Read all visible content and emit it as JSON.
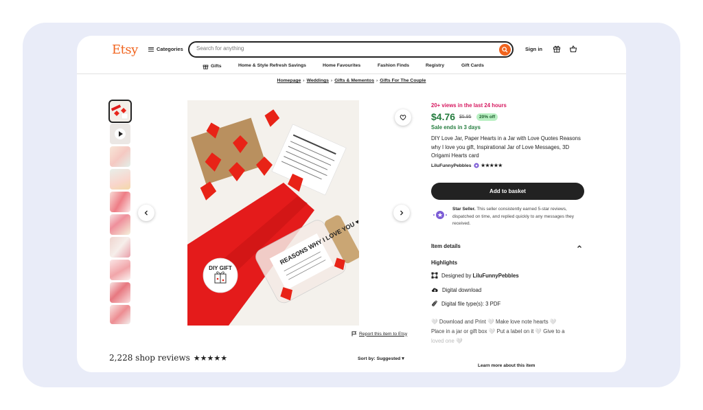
{
  "header": {
    "logo": "Etsy",
    "categories_label": "Categories",
    "search_placeholder": "Search for anything",
    "signin_label": "Sign in"
  },
  "nav": {
    "items": [
      "Gifts",
      "Home & Style Refresh Savings",
      "Home Favourites",
      "Fashion Finds",
      "Registry",
      "Gift Cards"
    ]
  },
  "breadcrumb": [
    "Homepage",
    "Weddings",
    "Gifts & Mementos",
    "Gifts For The Couple"
  ],
  "product": {
    "views": "20+ views in the last 24 hours",
    "price": "$4.76",
    "old_price": "$5.95",
    "discount": "20% off",
    "sale_ends": "Sale ends in 3 days",
    "title": "DIY Love Jar, Paper Hearts in a Jar with Love Quotes Reasons why I love you gift, Inspirational Jar of Love Messages, 3D Origami Hearts card",
    "seller": "LiluFunnyPebbles",
    "rating_stars": "★★★★★",
    "add_to_basket": "Add to basket",
    "star_seller_title": "Star Seller.",
    "star_seller_text": "This seller consistently earned 5-star reviews, dispatched on time, and replied quickly to any messages they received.",
    "image_badge": "DIY GIFT",
    "jar_label": "REASONS WHY I LOVE YOU ♥"
  },
  "details": {
    "heading": "Item details",
    "highlights_heading": "Highlights",
    "designed_by_prefix": "Designed by ",
    "designed_by": "LiluFunnyPebbles",
    "digital_download": "Digital download",
    "file_types": "Digital file type(s): 3 PDF",
    "description_line1": "🤍 Download and Print 🤍 Make love note hearts 🤍",
    "description_line2": "Place in a jar or gift box 🤍 Put a label on it 🤍 Give to a",
    "description_line3": "loved one 🤍",
    "learn_more": "Learn more about this item"
  },
  "report_link": "Report this item to Etsy",
  "reviews": {
    "count_text": "2,228 shop reviews",
    "stars": "★★★★★",
    "sort_label": "Sort by: Suggested"
  },
  "colors": {
    "brand": "#f1641e",
    "sale_green": "#247c3e",
    "views_pink": "#d6185f",
    "background_frame": "#e9ecf8"
  }
}
